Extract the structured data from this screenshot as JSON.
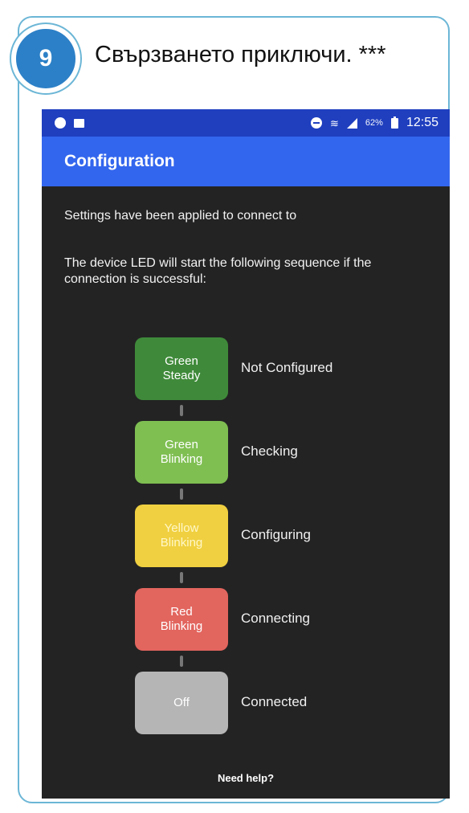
{
  "step": {
    "number": "9",
    "title": "Свързването приключи. ***"
  },
  "status_bar": {
    "battery_percent": "62%",
    "time": "12:55"
  },
  "app_bar": {
    "title": "Configuration"
  },
  "content": {
    "settings_text": "Settings have been applied to connect to",
    "sequence_text": "The device LED will start the following sequence if the connection is successful:"
  },
  "led_sequence": [
    {
      "led": "Green Steady",
      "status": "Not Configured",
      "color": "#3f8a3a",
      "text_color": "#ffffff"
    },
    {
      "led": "Green Blinking",
      "status": "Checking",
      "color": "#7fbf52",
      "text_color": "#ffffff"
    },
    {
      "led": "Yellow Blinking",
      "status": "Configuring",
      "color": "#f0d040",
      "text_color": "#fff7c8"
    },
    {
      "led": "Red Blinking",
      "status": "Connecting",
      "color": "#e2655e",
      "text_color": "#ffffff"
    },
    {
      "led": "Off",
      "status": "Connected",
      "color": "#b5b5b5",
      "text_color": "#ffffff"
    }
  ],
  "help": {
    "label": "Need help?"
  },
  "colors": {
    "step_badge": "#2c80c7",
    "card_border": "#6cb6d6",
    "app_bar": "#3366ee",
    "status_bar": "#1f3fbf",
    "screen_bg": "#232323"
  }
}
